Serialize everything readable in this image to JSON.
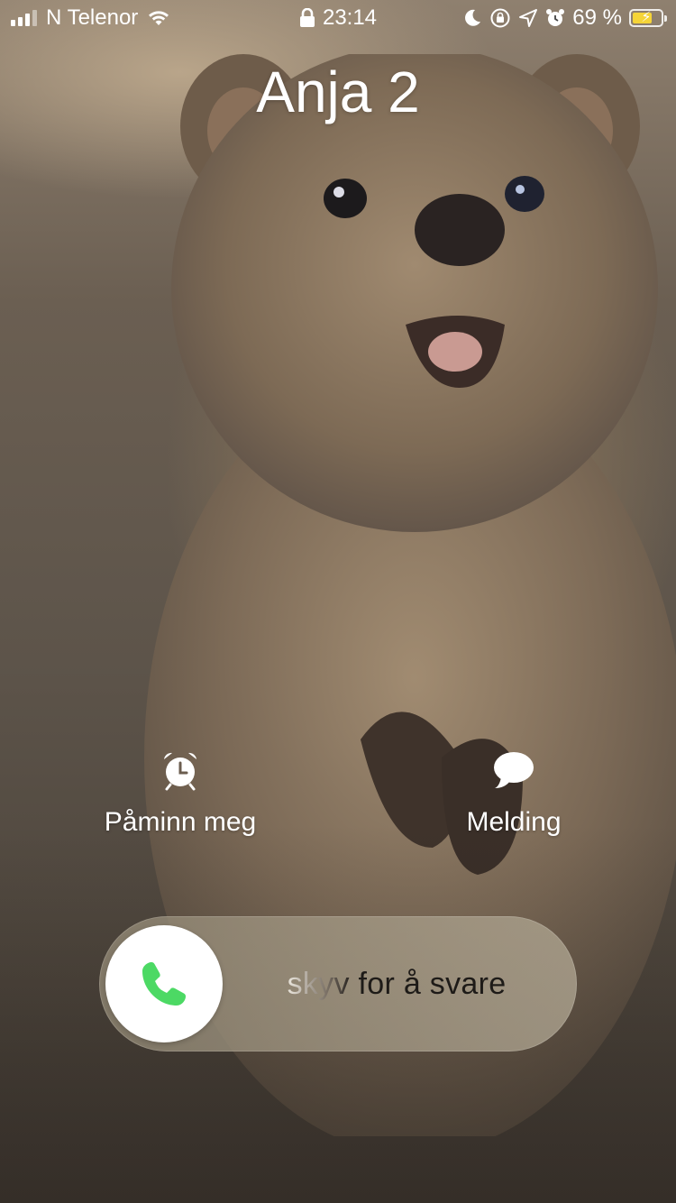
{
  "status_bar": {
    "carrier": "N Telenor",
    "time": "23:14",
    "battery_percent": "69 %",
    "battery_level": 0.69,
    "battery_color": "#f5d438"
  },
  "call": {
    "caller_name": "Anja 2"
  },
  "actions": {
    "remind": {
      "label": "Påminn meg",
      "icon": "alarm-clock-icon"
    },
    "message": {
      "label": "Melding",
      "icon": "speech-bubble-icon"
    }
  },
  "slider": {
    "text": "skyv for å svare",
    "knob_icon": "phone-icon",
    "accent": "#4cd964"
  }
}
